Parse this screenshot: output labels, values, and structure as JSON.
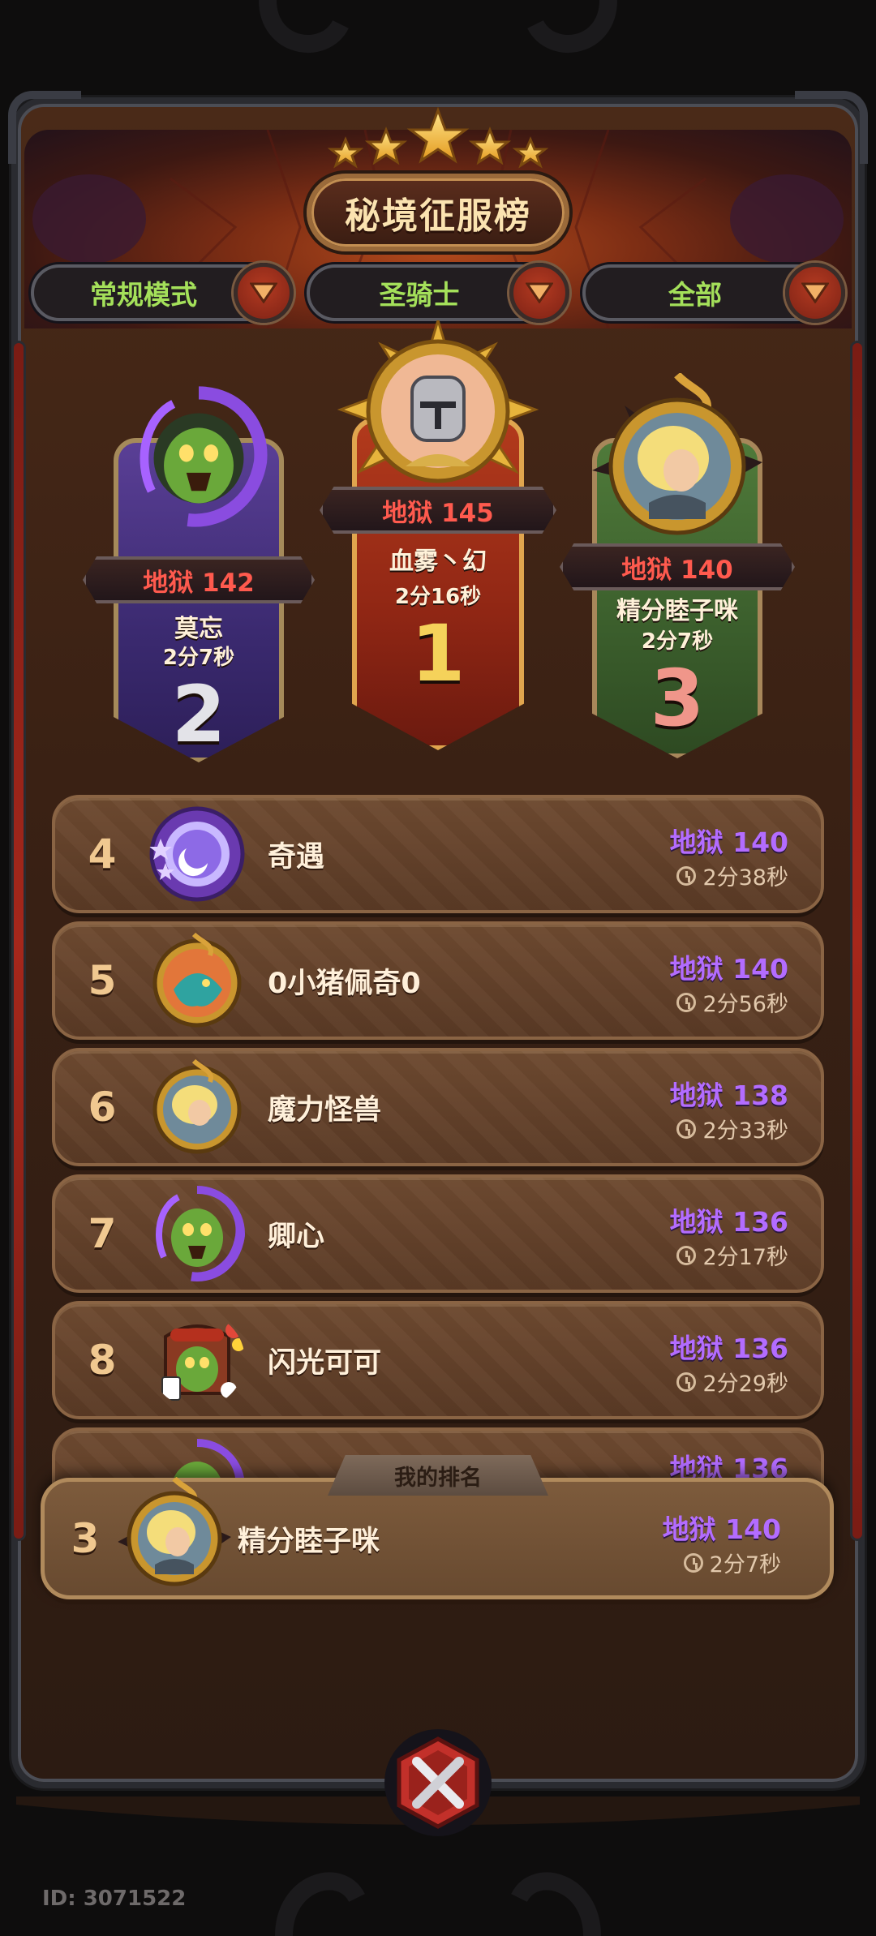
{
  "title": "秘境征服榜",
  "filters": [
    {
      "label": "常规模式"
    },
    {
      "label": "圣骑士"
    },
    {
      "label": "全部"
    }
  ],
  "podium": {
    "first": {
      "rank": "1",
      "score": "地狱 145",
      "name": "血雾丶幻",
      "time": "2分16秒"
    },
    "second": {
      "rank": "2",
      "score": "地狱 142",
      "name": "莫忘",
      "time": "2分7秒"
    },
    "third": {
      "rank": "3",
      "score": "地狱 140",
      "name": "精分睦子咪",
      "time": "2分7秒"
    }
  },
  "rows": [
    {
      "rank": "4",
      "name": "奇遇",
      "score": "地狱 140",
      "time": "2分38秒"
    },
    {
      "rank": "5",
      "name": "0小猪佩奇0",
      "score": "地狱 140",
      "time": "2分56秒"
    },
    {
      "rank": "6",
      "name": "魔力怪兽",
      "score": "地狱 138",
      "time": "2分33秒"
    },
    {
      "rank": "7",
      "name": "卿心",
      "score": "地狱 136",
      "time": "2分17秒"
    },
    {
      "rank": "8",
      "name": "闪光可可",
      "score": "地狱 136",
      "time": "2分29秒"
    },
    {
      "rank": "",
      "name": "",
      "score": "地狱 136",
      "time": ""
    }
  ],
  "my_rank": {
    "tab_label": "我的排名",
    "rank": "3",
    "name": "精分睦子咪",
    "score": "地狱 140",
    "time": "2分7秒"
  },
  "footer": {
    "id_text": "ID: 3071522"
  },
  "colors": {
    "accent_green": "#a4e05a",
    "score_purple": "#b36cff",
    "hell_red": "#ff5a4e",
    "rank_gold": "#f5d25a"
  },
  "icons": {
    "dropdown": "chevron-down-icon",
    "clock": "clock-icon",
    "close": "close-icon"
  }
}
